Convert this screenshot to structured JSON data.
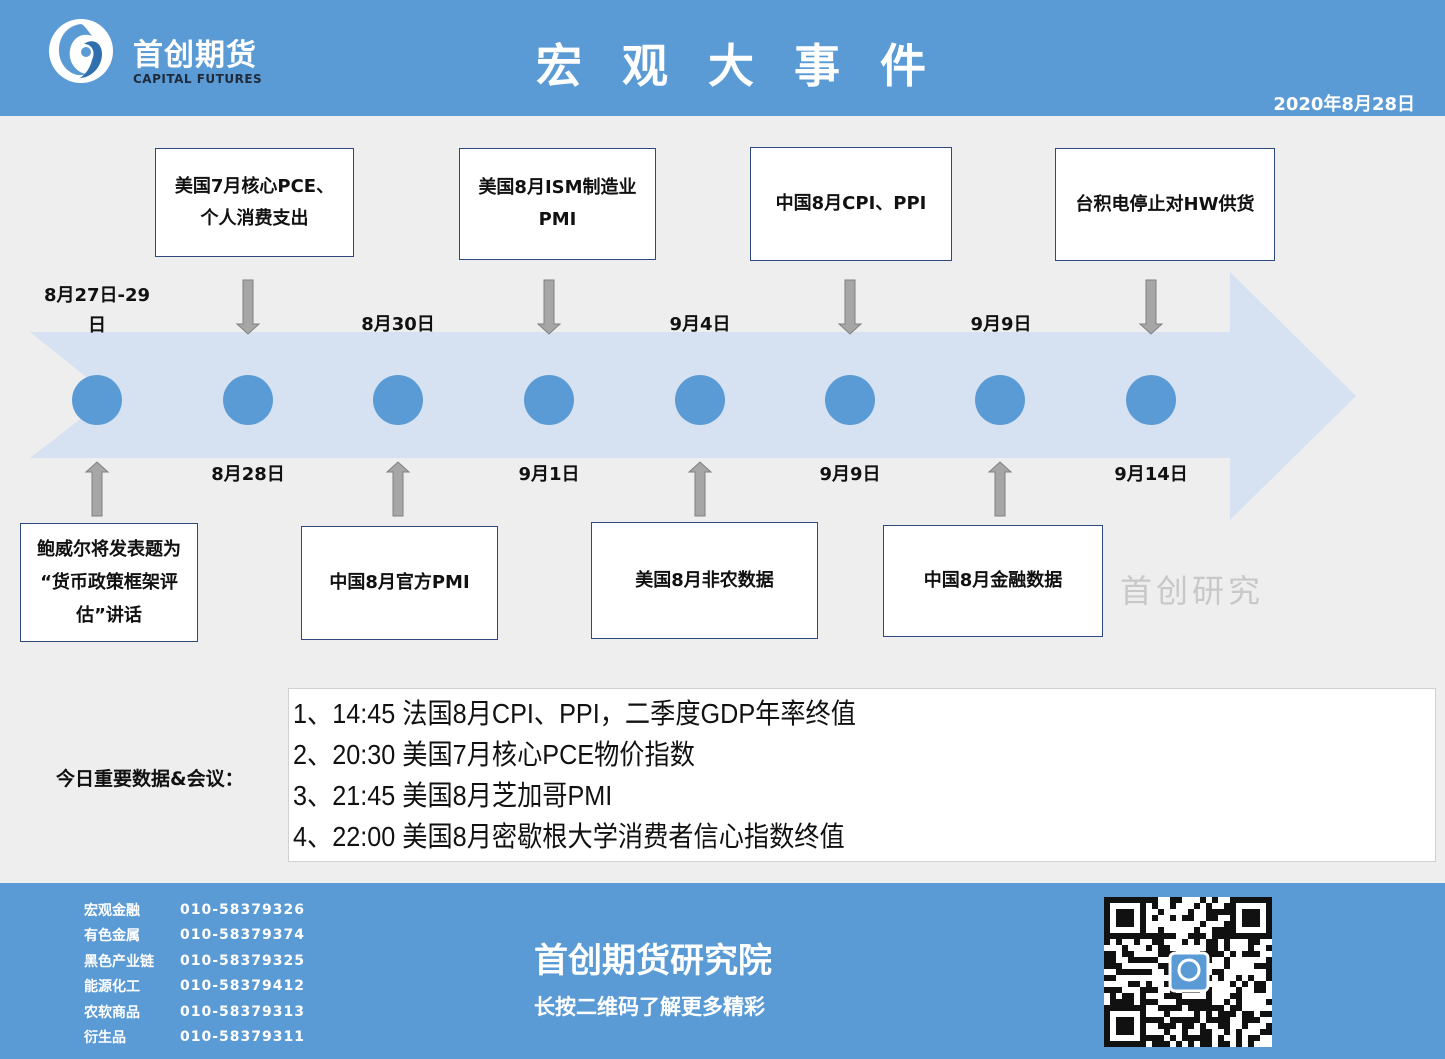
{
  "header": {
    "logo_cn": "首创期货",
    "logo_en": "CAPITAL FUTURES",
    "title": "宏 观 大 事 件",
    "date": "2020年8月28日"
  },
  "timeline": {
    "dates": [
      {
        "line1": "8月27日-29",
        "line2": "日"
      },
      {
        "line1": "8月28日",
        "line2": ""
      },
      {
        "line1": "8月30日",
        "line2": ""
      },
      {
        "line1": "9月1日",
        "line2": ""
      },
      {
        "line1": "9月4日",
        "line2": ""
      },
      {
        "line1": "9月9日",
        "line2": ""
      },
      {
        "line1": "9月9日",
        "line2": ""
      },
      {
        "line1": "9月14日",
        "line2": ""
      }
    ],
    "events": [
      {
        "line1": "鲍威尔将发表题为",
        "line2": "“货币政策框架评",
        "line3": "估”讲话"
      },
      {
        "line1": "美国7月核心PCE、",
        "line2": "个人消费支出",
        "line3": ""
      },
      {
        "line1": "中国8月官方PMI",
        "line2": "",
        "line3": ""
      },
      {
        "line1": "美国8月ISM制造业",
        "line2": "PMI",
        "line3": ""
      },
      {
        "line1": "美国8月非农数据",
        "line2": "",
        "line3": ""
      },
      {
        "line1": "中国8月CPI、PPI",
        "line2": "",
        "line3": ""
      },
      {
        "line1": "中国8月金融数据",
        "line2": "",
        "line3": ""
      },
      {
        "line1": "台积电停止对HW供货",
        "line2": "",
        "line3": ""
      }
    ],
    "arrow_color": "#d6e2f1",
    "dot_color": "#5b9bd5",
    "pointer_color": "#a6a6a6"
  },
  "watermark": "首创研究",
  "today": {
    "label": "今日重要数据&会议：",
    "items": [
      "1、14:45 法国8月CPI、PPI，二季度GDP年率终值",
      "2、20:30 美国7月核心PCE物价指数",
      "3、21:45 美国8月芝加哥PMI",
      "4、22:00 美国8月密歇根大学消费者信心指数终值"
    ]
  },
  "footer": {
    "contacts": [
      {
        "name": "宏观金融",
        "phone": "010-58379326"
      },
      {
        "name": "有色金属",
        "phone": "010-58379374"
      },
      {
        "name": "黑色产业链",
        "phone": "010-58379325"
      },
      {
        "name": "能源化工",
        "phone": "010-58379412"
      },
      {
        "name": "农软商品",
        "phone": "010-58379313"
      },
      {
        "name": "衍生品",
        "phone": "010-58379311"
      }
    ],
    "title": "首创期货研究院",
    "subtitle": "长按二维码了解更多精彩",
    "qr_icon": "qr-code-icon"
  },
  "colors": {
    "brand_blue": "#5b9bd5",
    "box_border": "#2e4a7d"
  }
}
